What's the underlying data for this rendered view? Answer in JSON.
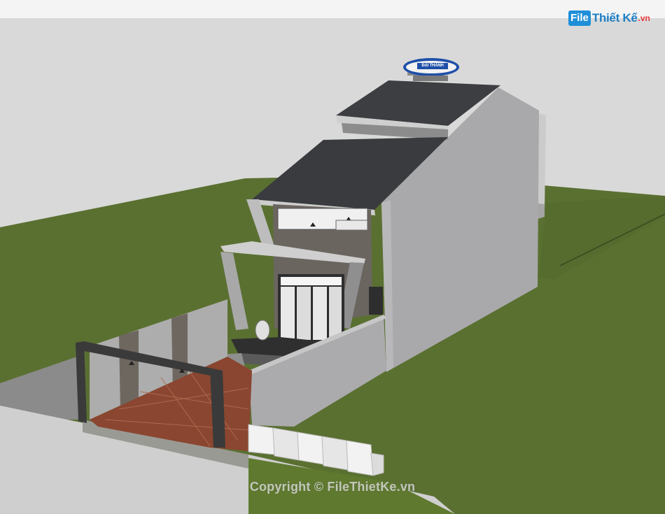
{
  "logo": {
    "part1": "File",
    "part2": "Thiết Kế",
    "part3": ".vn"
  },
  "tank": {
    "brand": "ĐẠI THÀNH"
  },
  "watermark": {
    "text": "Copyright © FileThietKe.vn"
  },
  "colors": {
    "lawn": "#5a7031",
    "sky": "#d9d9d9",
    "roof": "#3d3e42",
    "wall": "#a9a9ab",
    "floor_tile": "#8a4630",
    "accent": "#1e8fd8"
  }
}
